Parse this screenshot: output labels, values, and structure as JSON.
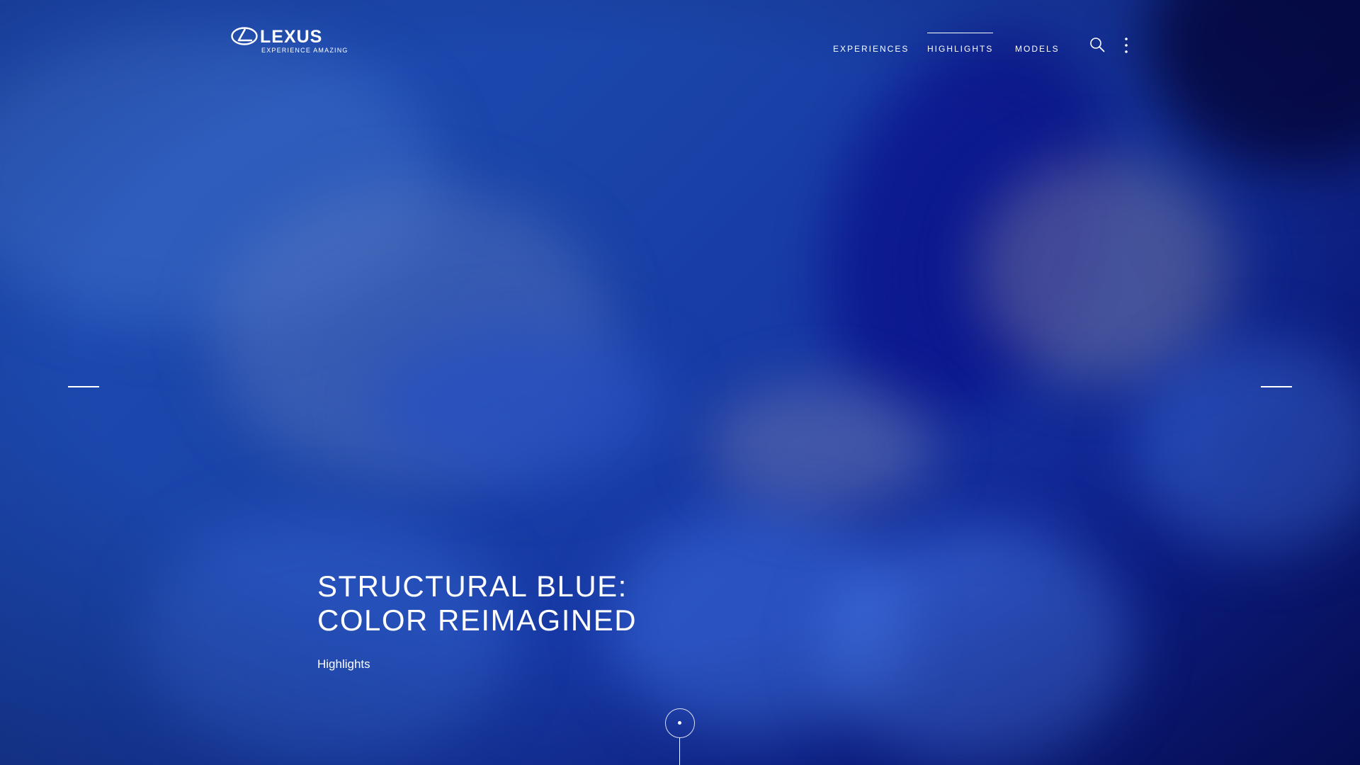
{
  "brand": {
    "name": "LEXUS",
    "tagline": "EXPERIENCE AMAZING",
    "logo_icon": "lexus-l-emblem"
  },
  "nav": {
    "items": [
      {
        "label": "EXPERIENCES",
        "active": false
      },
      {
        "label": "HIGHLIGHTS",
        "active": true
      },
      {
        "label": "MODELS",
        "active": false
      }
    ],
    "search_icon": "search-icon",
    "more_icon": "vertical-dots-icon"
  },
  "hero": {
    "title_line1": "STRUCTURAL BLUE:",
    "title_line2": "COLOR REIMAGINED",
    "category": "Highlights"
  },
  "carousel": {
    "prev_icon": "dash-left-arrow",
    "next_icon": "dash-right-arrow"
  },
  "colors": {
    "background": "#1a44a8",
    "text": "#ffffff"
  }
}
